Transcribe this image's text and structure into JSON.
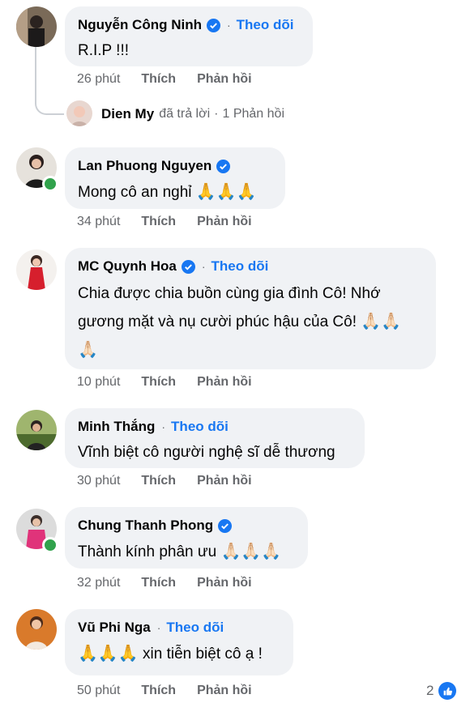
{
  "labels": {
    "like": "Thích",
    "reply": "Phản hồi",
    "follow": "Theo dõi",
    "dot": "·"
  },
  "colors": {
    "accent": "#1877f2",
    "bubble": "#f0f2f5",
    "online": "#31a24c",
    "muted": "#65676b"
  },
  "comments": [
    {
      "name": "Nguyễn Công Ninh",
      "verified": true,
      "follow": true,
      "text": "R.I.P !!!",
      "time": "26 phút"
    },
    {
      "name": "Lan Phuong Nguyen",
      "verified": true,
      "follow": false,
      "text": "Mong cô an nghỉ",
      "emoji": "🙏🙏🙏",
      "time": "34 phút",
      "online": true
    },
    {
      "name": "MC Quynh Hoa",
      "verified": true,
      "follow": true,
      "text_line1": "Chia được chia  buồn cùng gia đình Cô! Nhớ",
      "text_line2": "gương mặt và nụ cười phúc hậu của Cô!",
      "emoji_inline": "🙏🏻🙏🏻",
      "emoji_line3": "🙏🏻",
      "time": "10 phút"
    },
    {
      "name": "Minh Thắng",
      "verified": false,
      "follow": true,
      "text": "Vĩnh biệt cô người nghệ sĩ dễ thương",
      "time": "30 phút"
    },
    {
      "name": "Chung Thanh Phong",
      "verified": true,
      "follow": false,
      "text": "Thành kính phân ưu",
      "emoji": "🙏🏻🙏🏻🙏🏻",
      "time": "32 phút",
      "online": true
    },
    {
      "name": "Vũ Phi Nga",
      "verified": false,
      "follow": true,
      "emoji": "🙏🙏🙏",
      "text": "xin tiễn biệt cô ạ !",
      "time": "50 phút",
      "reactions": "2"
    }
  ],
  "reply_thread": {
    "name": "Dien My",
    "action": "đã trả lời",
    "count": "1 Phản hồi"
  }
}
